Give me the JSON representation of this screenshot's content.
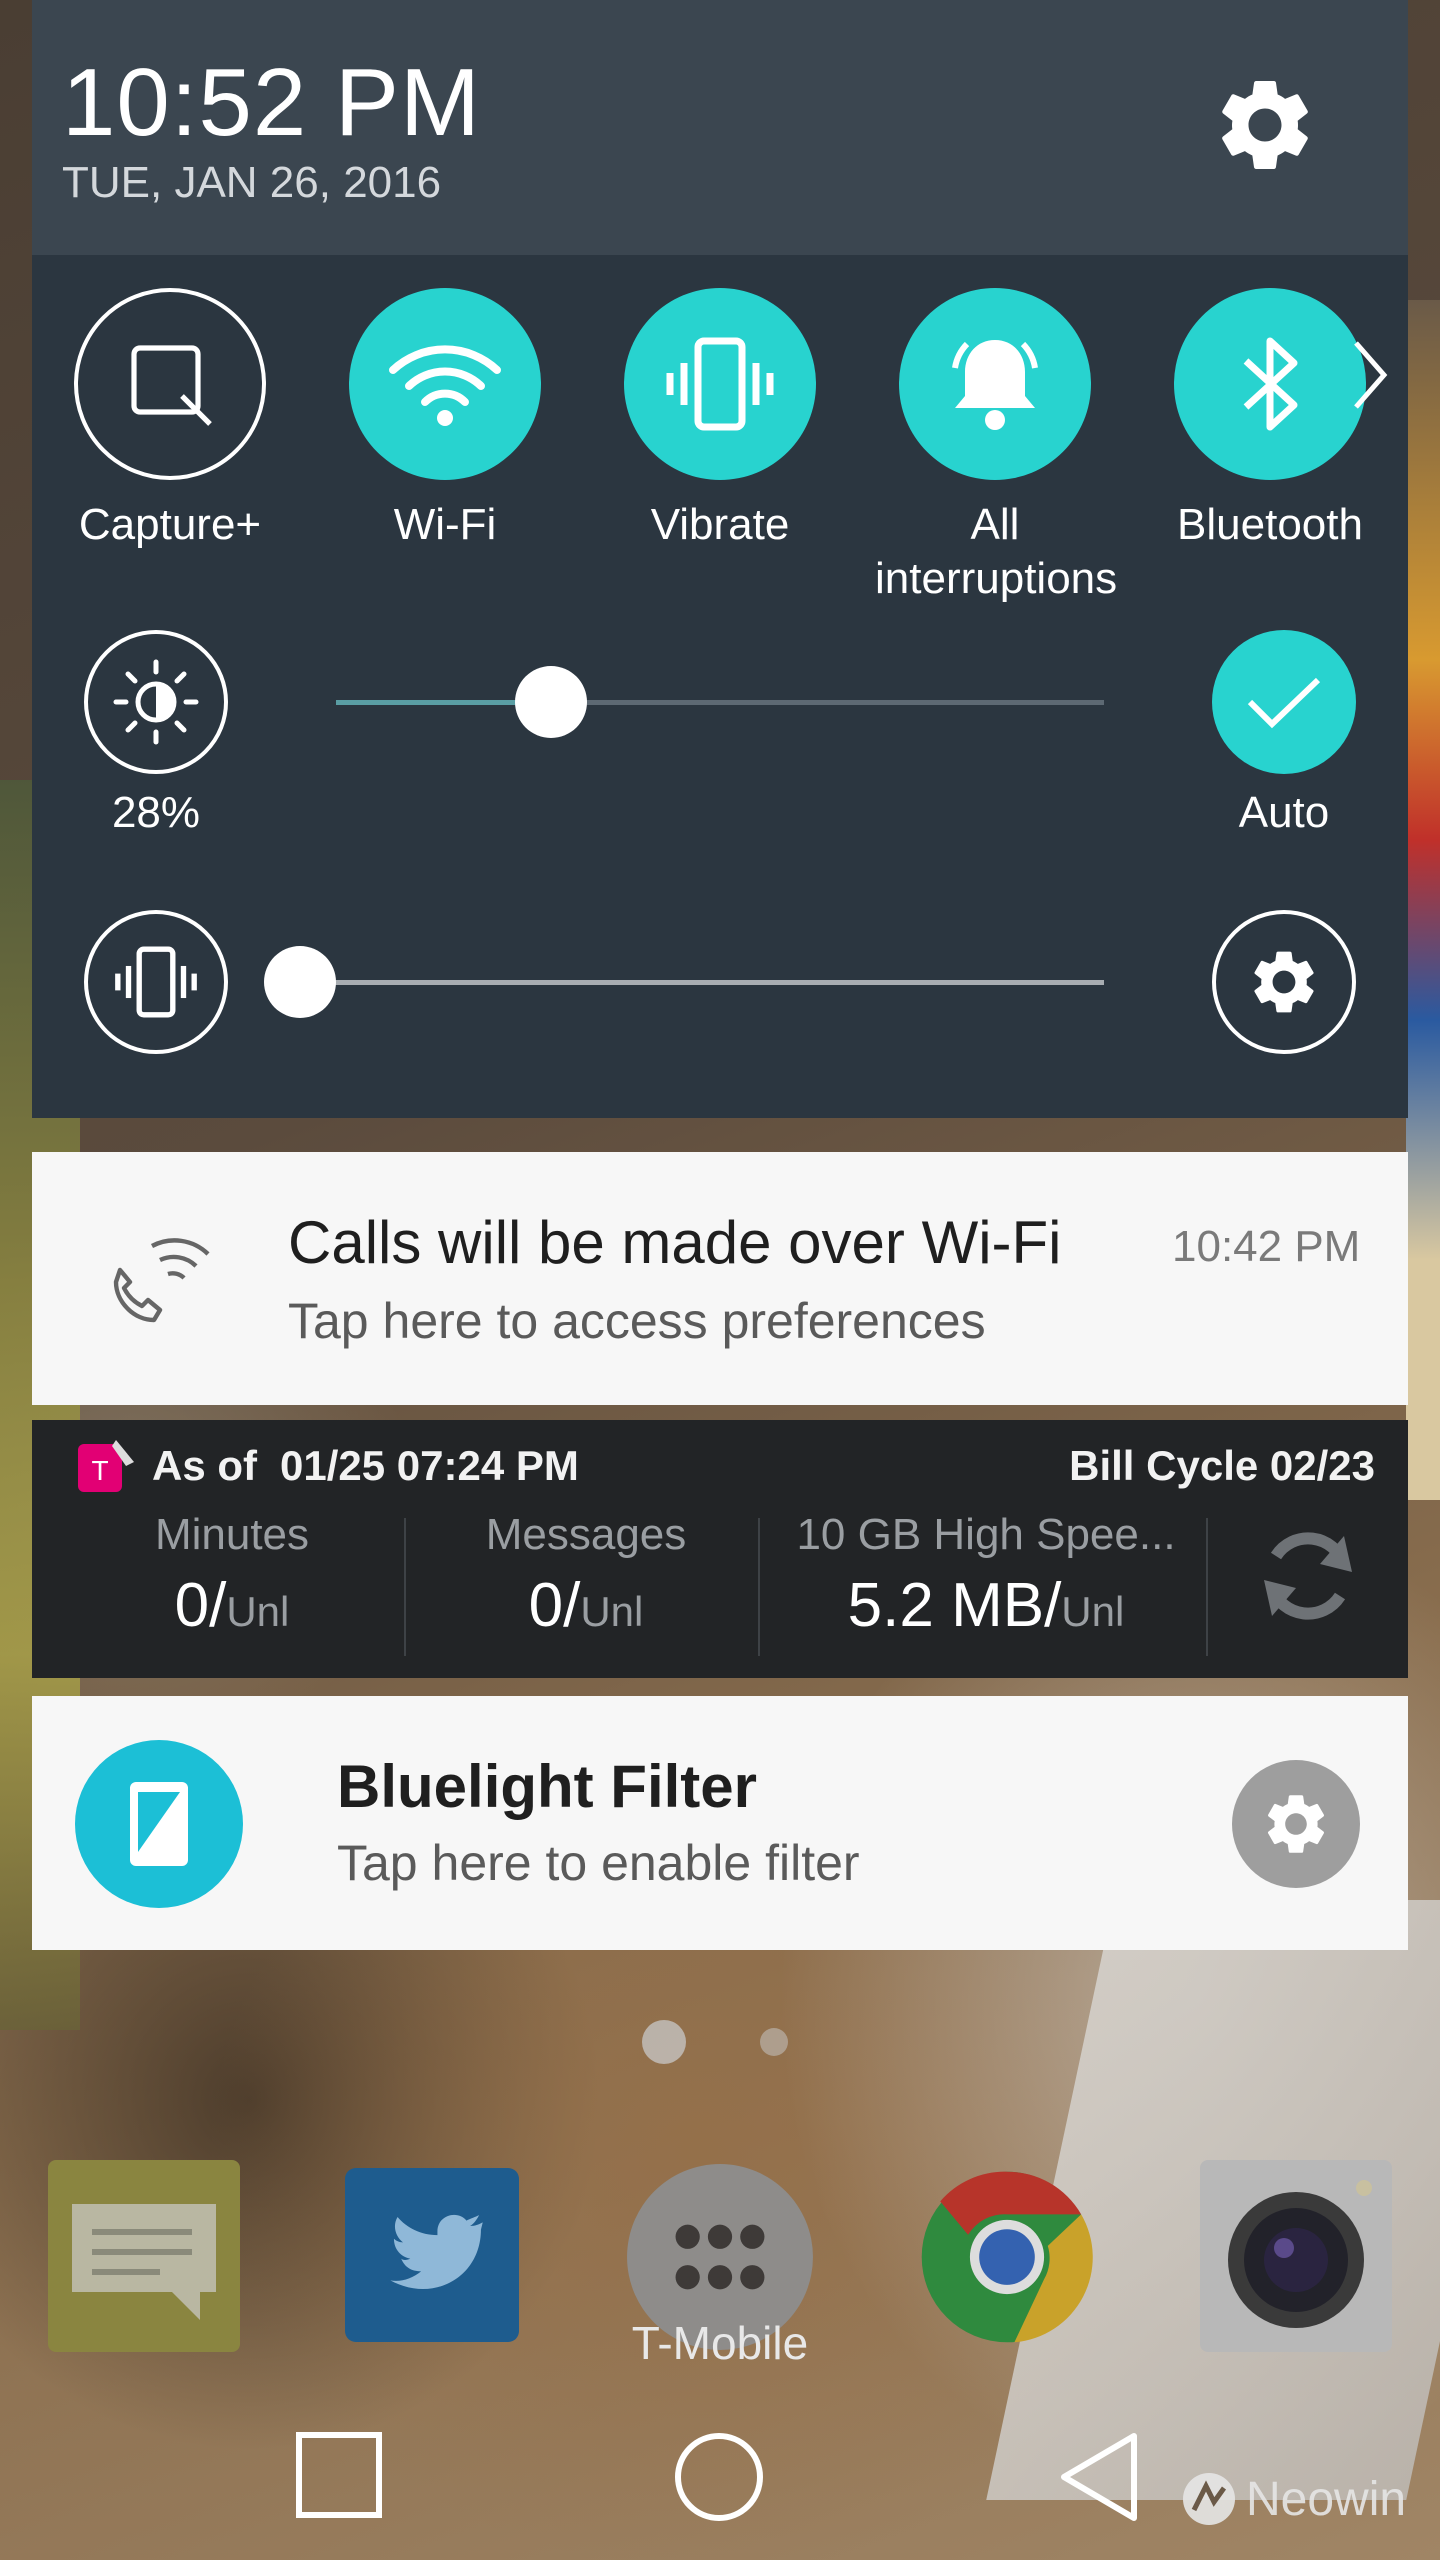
{
  "status": {
    "time": "10:52 PM",
    "date": "TUE, JAN 26, 2016"
  },
  "quick_settings": {
    "tiles": [
      {
        "label": "Capture+",
        "icon": "capture-plus-icon",
        "active": false
      },
      {
        "label": "Wi-Fi",
        "icon": "wifi-icon",
        "active": true
      },
      {
        "label": "Vibrate",
        "icon": "vibrate-icon",
        "active": true
      },
      {
        "label": "All interruptions",
        "icon": "bell-icon",
        "active": true
      },
      {
        "label": "Bluetooth",
        "icon": "bluetooth-icon",
        "active": true
      }
    ],
    "brightness": {
      "value_label": "28%",
      "level": 0.28,
      "auto_label": "Auto",
      "auto_on": true
    },
    "volume": {
      "level": 0.0
    },
    "accent_color": "#28d3cf"
  },
  "notifications": {
    "wifi_calling": {
      "title": "Calls will be made over Wi-Fi",
      "subtitle": "Tap here to access preferences",
      "time": "10:42 PM"
    },
    "tmobile_usage": {
      "as_of_label": "As of",
      "as_of_value": "01/25 07:24 PM",
      "bill_cycle": "Bill Cycle 02/23",
      "columns": [
        {
          "title": "Minutes",
          "value": "0/",
          "unit": "Unl"
        },
        {
          "title": "Messages",
          "value": "0/",
          "unit": "Unl"
        },
        {
          "title": "10 GB High Spee...",
          "value": "5.2 MB/",
          "unit": "Unl"
        }
      ]
    },
    "bluelight": {
      "title": "Bluelight Filter",
      "subtitle": "Tap here to enable filter"
    }
  },
  "home": {
    "dock_label": "T-Mobile",
    "dock_apps": [
      "messaging-icon",
      "twitter-icon",
      "apps-drawer-icon",
      "chrome-icon",
      "camera-icon"
    ]
  },
  "watermark": "Neowin"
}
